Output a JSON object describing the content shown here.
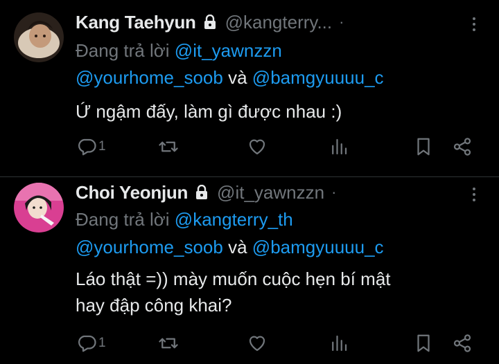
{
  "tweets": [
    {
      "name": "Kang Taehyun",
      "handle": "@kangterry...",
      "dot": "·",
      "reply_prefix": "Đang trả lời",
      "reply_to_1": "@it_yawnzzn",
      "reply_to_2": "@yourhome_soob",
      "and_word": "và",
      "reply_to_3": "@bamgyuuuu_c",
      "text_lines": [
        "Ứ ngậm đấy, làm gì được nhau :)"
      ],
      "reply_count": "1",
      "avatar_colors": [
        "#4a3a2f",
        "#c9b7a3"
      ]
    },
    {
      "name": "Choi Yeonjun",
      "handle": "@it_yawnzzn",
      "dot": "·",
      "reply_prefix": "Đang trả lời",
      "reply_to_1": "@kangterry_th",
      "reply_to_2": "@yourhome_soob",
      "and_word": "và",
      "reply_to_3": "@bamgyuuuu_c",
      "text_lines": [
        "Láo thật =)) mày muốn cuộc hẹn bí mật",
        "hay đập công khai?"
      ],
      "reply_count": "1",
      "avatar_colors": [
        "#d93f92",
        "#f1a7c8"
      ]
    }
  ],
  "colors": {
    "background": "#000000",
    "primary_text": "#e7e9ea",
    "secondary_text": "#71767b",
    "link": "#1d9bf0",
    "divider": "#2f3336"
  }
}
